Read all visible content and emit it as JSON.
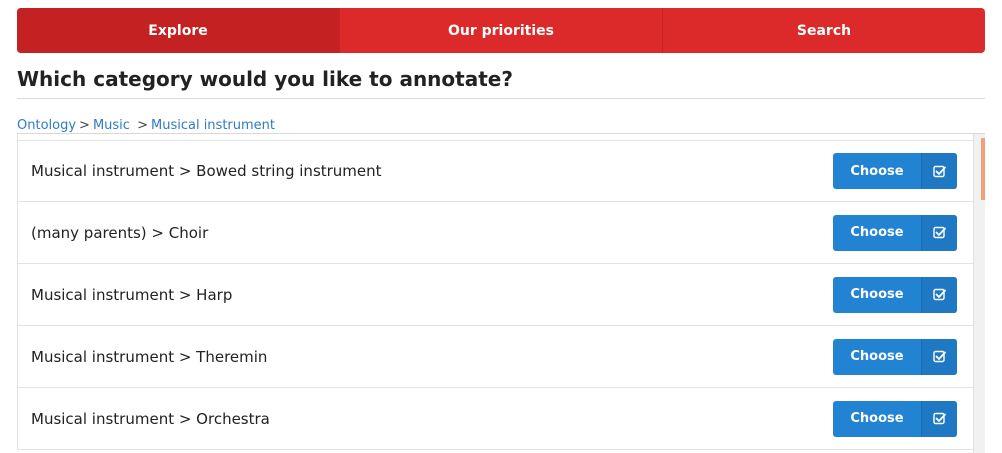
{
  "tabs": [
    {
      "label": "Explore",
      "active": true
    },
    {
      "label": "Our priorities",
      "active": false
    },
    {
      "label": "Search",
      "active": false
    }
  ],
  "heading": "Which category would you like to annotate?",
  "breadcrumb": {
    "items": [
      "Ontology",
      "Music",
      "Musical instrument"
    ],
    "separator": ">"
  },
  "rows": [
    {
      "label": "Musical instrument > Bowed string instrument",
      "button": "Choose"
    },
    {
      "label": "(many parents) > Choir",
      "button": "Choose"
    },
    {
      "label": "Musical instrument > Harp",
      "button": "Choose"
    },
    {
      "label": "Musical instrument > Theremin",
      "button": "Choose"
    },
    {
      "label": "Musical instrument > Orchestra",
      "button": "Choose"
    }
  ],
  "icons": {
    "choose": "checkbox-icon"
  },
  "colors": {
    "tab_bar": "#dc2a2a",
    "tab_active": "#c42222",
    "button": "#2283d2",
    "link": "#2e7bc6",
    "scroll_thumb": "#f0a07a"
  }
}
